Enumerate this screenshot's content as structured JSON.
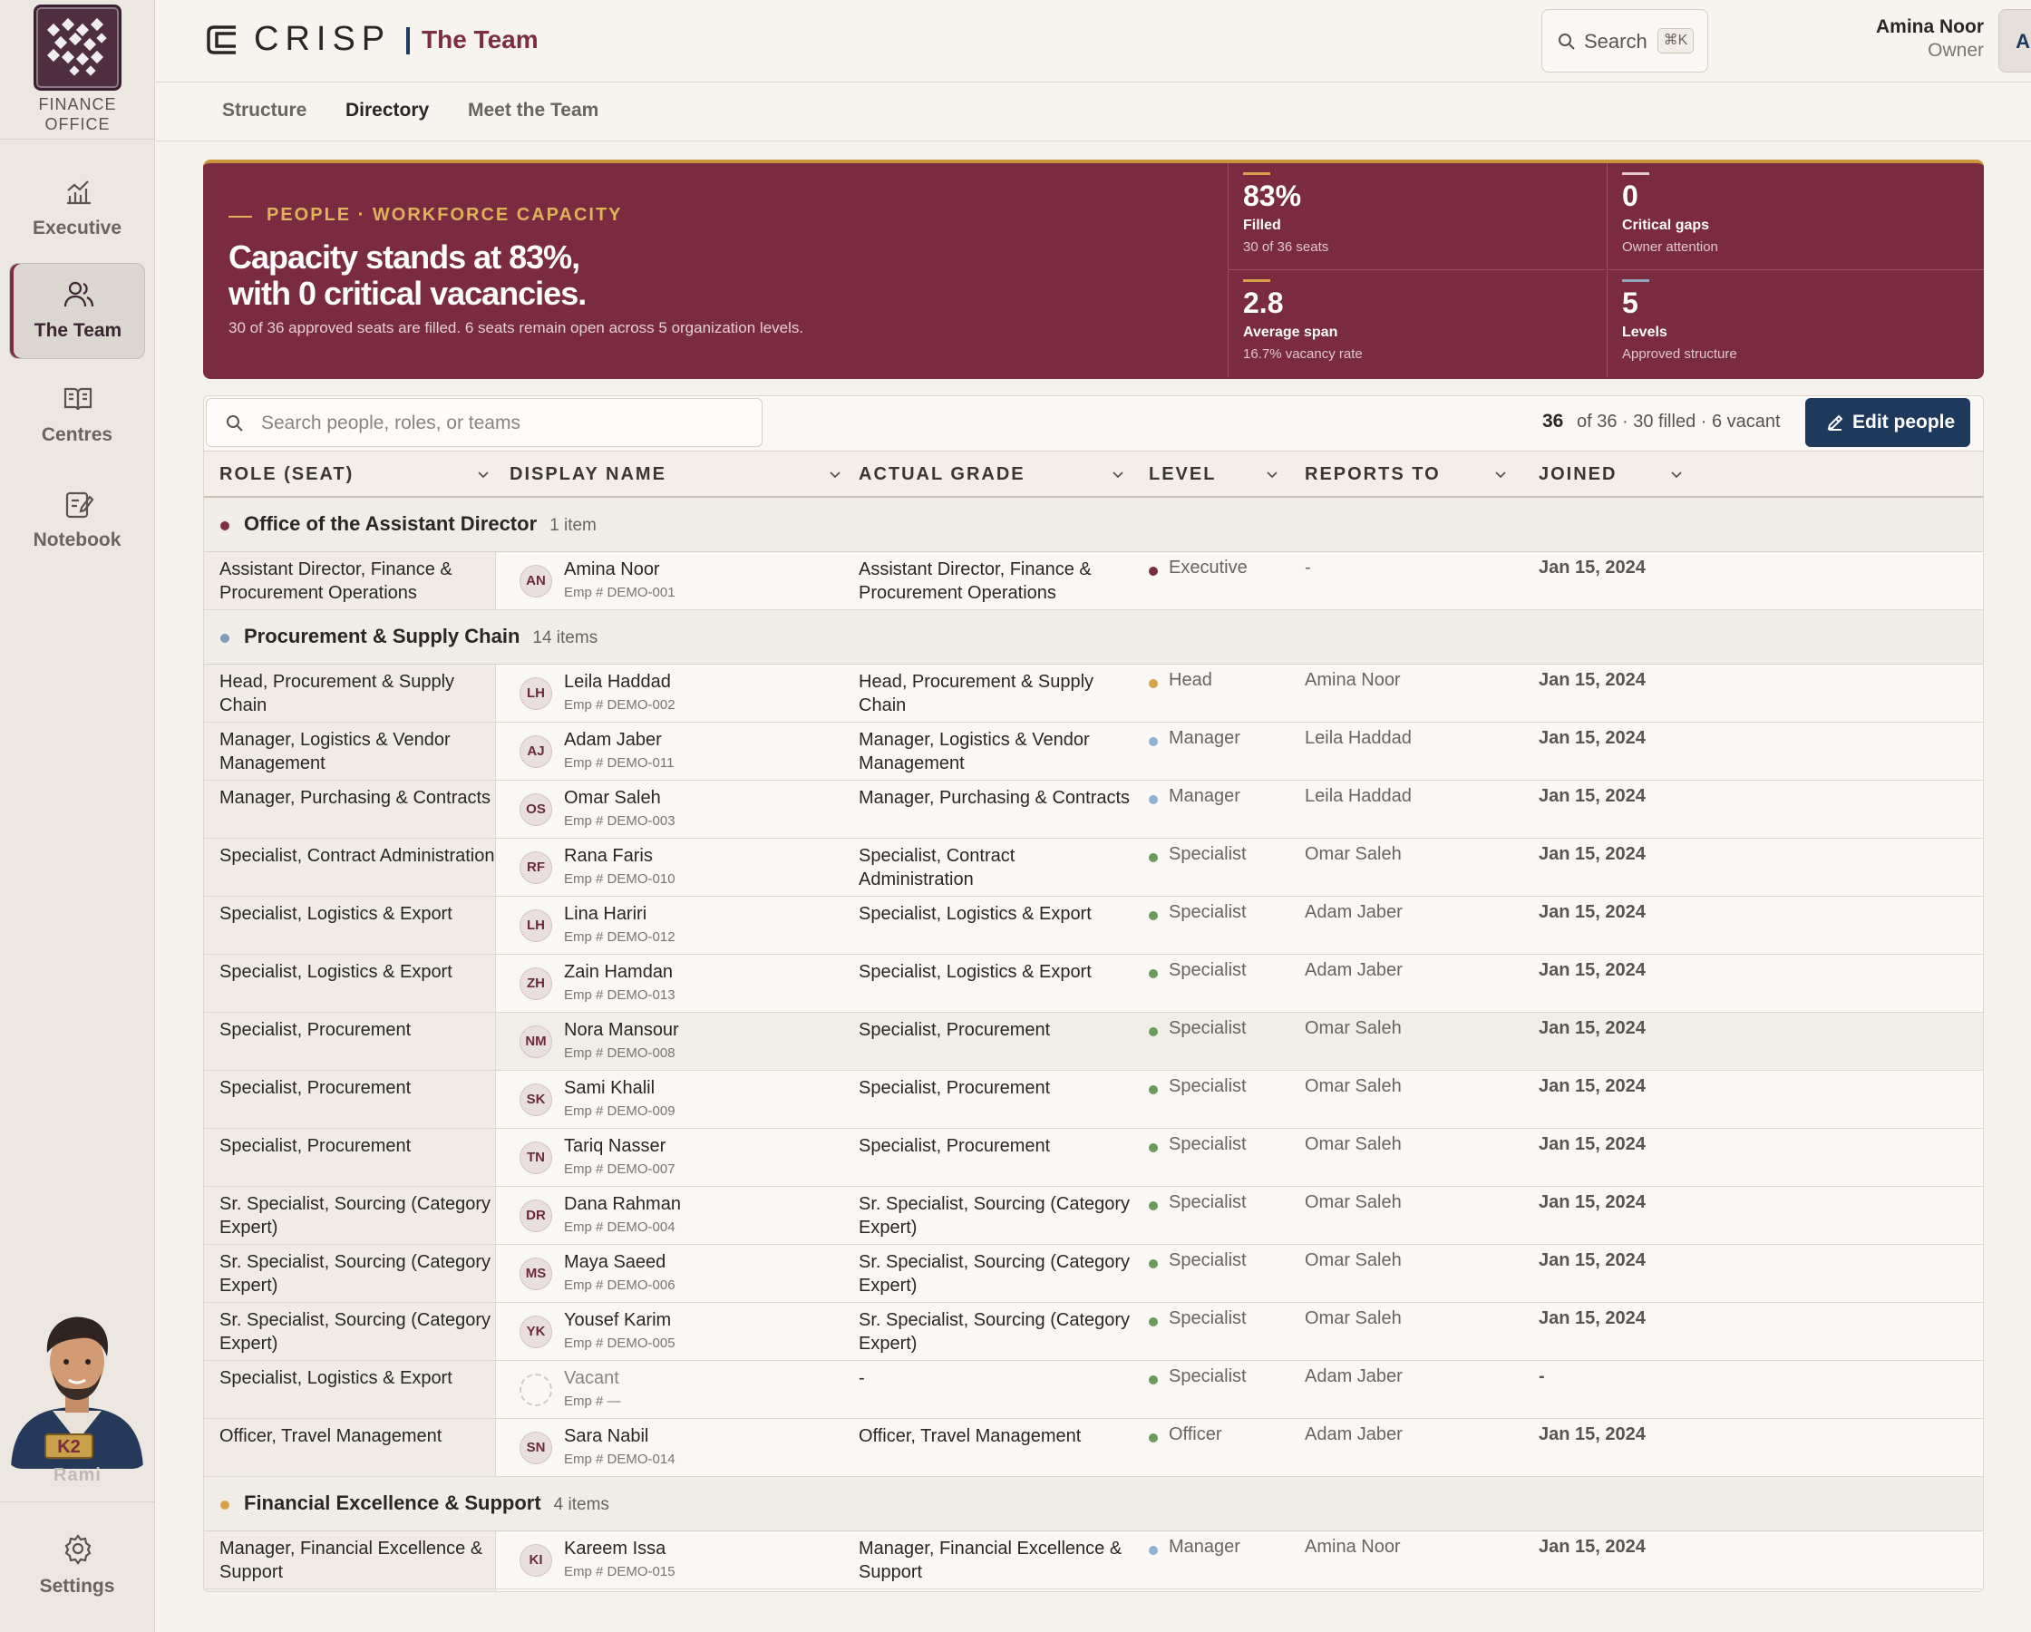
{
  "app": {
    "brand_name": "CRISP",
    "office_line1": "FINANCE",
    "office_line2": "OFFICE",
    "page_title": "The Team"
  },
  "sidebar": {
    "items": [
      {
        "label": "Executive",
        "icon": "chart-icon"
      },
      {
        "label": "The Team",
        "icon": "people-icon",
        "active": true
      },
      {
        "label": "Centres",
        "icon": "book-icon"
      },
      {
        "label": "Notebook",
        "icon": "notebook-icon"
      }
    ],
    "assistant_name": "Rami",
    "assistant_badge": "K2",
    "settings_label": "Settings"
  },
  "header": {
    "search_label": "Search",
    "search_shortcut": "⌘K",
    "user_name": "Amina Noor",
    "user_role": "Owner",
    "user_initials": "AN"
  },
  "tabs": [
    {
      "label": "Structure"
    },
    {
      "label": "Directory",
      "active": true
    },
    {
      "label": "Meet the Team"
    }
  ],
  "hero": {
    "kicker": "PEOPLE · WORKFORCE CAPACITY",
    "headline_1": "Capacity stands at 83%,",
    "headline_2": "with 0 critical vacancies.",
    "subtext": "30 of 36 approved seats are filled. 6 seats remain open across 5 organization levels.",
    "kpis": [
      {
        "value": "83%",
        "label": "Filled",
        "sub": "30 of 36 seats",
        "bar_color": "#d8a24a"
      },
      {
        "value": "0",
        "label": "Critical gaps",
        "sub": "Owner attention",
        "bar_color": "#e6c9cf"
      },
      {
        "value": "2.8",
        "label": "Average span",
        "sub": "16.7% vacancy rate",
        "bar_color": "#d8a24a"
      },
      {
        "value": "5",
        "label": "Levels",
        "sub": "Approved structure",
        "bar_color": "#8fa7bd"
      }
    ]
  },
  "table": {
    "search_placeholder": "Search people, roles, or teams",
    "count": "36",
    "count_summary": "of 36 · 30 filled · 6 vacant",
    "edit_label": "Edit people",
    "columns": [
      "ROLE (SEAT)",
      "DISPLAY NAME",
      "ACTUAL GRADE",
      "LEVEL",
      "REPORTS TO",
      "JOINED"
    ],
    "groups": [
      {
        "name": "Office of the Assistant Director",
        "count": "1 item",
        "color": "#7d2d40"
      },
      {
        "name": "Procurement & Supply Chain",
        "count": "14 items",
        "color": "#7f9cb8"
      },
      {
        "name": "Financial Excellence & Support",
        "count": "4 items",
        "color": "#d8a24a"
      }
    ],
    "level_colors": {
      "Executive": "#7d2d40",
      "Head": "#d8a24a",
      "Manager": "#8fb0d6",
      "Specialist": "#6c9a5c",
      "Officer": "#6c9a5c"
    },
    "rows": [
      {
        "role": "Assistant Director, Finance & Procurement Operations",
        "initials": "AN",
        "name": "Amina Noor",
        "emp": "Emp # DEMO-001",
        "grade": "Assistant Director, Finance & Procurement Operations",
        "level": "Executive",
        "reports": "-",
        "joined": "Jan 15, 2024"
      },
      {
        "role": "Head, Procurement & Supply Chain",
        "initials": "LH",
        "name": "Leila Haddad",
        "emp": "Emp # DEMO-002",
        "grade": "Head, Procurement & Supply Chain",
        "level": "Head",
        "reports": "Amina Noor",
        "joined": "Jan 15, 2024"
      },
      {
        "role": "Manager, Logistics & Vendor Management",
        "initials": "AJ",
        "name": "Adam Jaber",
        "emp": "Emp # DEMO-011",
        "grade": "Manager, Logistics & Vendor Management",
        "level": "Manager",
        "reports": "Leila Haddad",
        "joined": "Jan 15, 2024"
      },
      {
        "role": "Manager, Purchasing & Contracts",
        "initials": "OS",
        "name": "Omar Saleh",
        "emp": "Emp # DEMO-003",
        "grade": "Manager, Purchasing & Contracts",
        "level": "Manager",
        "reports": "Leila Haddad",
        "joined": "Jan 15, 2024"
      },
      {
        "role": "Specialist, Contract Administration",
        "initials": "RF",
        "name": "Rana Faris",
        "emp": "Emp # DEMO-010",
        "grade": "Specialist, Contract Administration",
        "level": "Specialist",
        "reports": "Omar Saleh",
        "joined": "Jan 15, 2024"
      },
      {
        "role": "Specialist, Logistics & Export",
        "initials": "LH",
        "name": "Lina Hariri",
        "emp": "Emp # DEMO-012",
        "grade": "Specialist, Logistics & Export",
        "level": "Specialist",
        "reports": "Adam Jaber",
        "joined": "Jan 15, 2024"
      },
      {
        "role": "Specialist, Logistics & Export",
        "initials": "ZH",
        "name": "Zain Hamdan",
        "emp": "Emp # DEMO-013",
        "grade": "Specialist, Logistics & Export",
        "level": "Specialist",
        "reports": "Adam Jaber",
        "joined": "Jan 15, 2024"
      },
      {
        "role": "Specialist, Procurement",
        "initials": "NM",
        "name": "Nora Mansour",
        "emp": "Emp # DEMO-008",
        "grade": "Specialist, Procurement",
        "level": "Specialist",
        "reports": "Omar Saleh",
        "joined": "Jan 15, 2024",
        "highlight": true
      },
      {
        "role": "Specialist, Procurement",
        "initials": "SK",
        "name": "Sami Khalil",
        "emp": "Emp # DEMO-009",
        "grade": "Specialist, Procurement",
        "level": "Specialist",
        "reports": "Omar Saleh",
        "joined": "Jan 15, 2024"
      },
      {
        "role": "Specialist, Procurement",
        "initials": "TN",
        "name": "Tariq Nasser",
        "emp": "Emp # DEMO-007",
        "grade": "Specialist, Procurement",
        "level": "Specialist",
        "reports": "Omar Saleh",
        "joined": "Jan 15, 2024"
      },
      {
        "role": "Sr. Specialist, Sourcing (Category Expert)",
        "initials": "DR",
        "name": "Dana Rahman",
        "emp": "Emp # DEMO-004",
        "grade": "Sr. Specialist, Sourcing (Category Expert)",
        "level": "Specialist",
        "reports": "Omar Saleh",
        "joined": "Jan 15, 2024"
      },
      {
        "role": "Sr. Specialist, Sourcing (Category Expert)",
        "initials": "MS",
        "name": "Maya Saeed",
        "emp": "Emp # DEMO-006",
        "grade": "Sr. Specialist, Sourcing (Category Expert)",
        "level": "Specialist",
        "reports": "Omar Saleh",
        "joined": "Jan 15, 2024"
      },
      {
        "role": "Sr. Specialist, Sourcing (Category Expert)",
        "initials": "YK",
        "name": "Yousef Karim",
        "emp": "Emp # DEMO-005",
        "grade": "Sr. Specialist, Sourcing (Category Expert)",
        "level": "Specialist",
        "reports": "Omar Saleh",
        "joined": "Jan 15, 2024"
      },
      {
        "role": "Specialist, Logistics & Export",
        "initials": "",
        "name": "Vacant",
        "emp": "Emp # —",
        "grade": "-",
        "level": "Specialist",
        "reports": "Adam Jaber",
        "joined": "-",
        "vacant": true
      },
      {
        "role": "Officer, Travel Management",
        "initials": "SN",
        "name": "Sara Nabil",
        "emp": "Emp # DEMO-014",
        "grade": "Officer, Travel Management",
        "level": "Officer",
        "reports": "Adam Jaber",
        "joined": "Jan 15, 2024"
      },
      {
        "role": "Manager, Financial Excellence & Support",
        "initials": "KI",
        "name": "Kareem Issa",
        "emp": "Emp # DEMO-015",
        "grade": "Manager, Financial Excellence & Support",
        "level": "Manager",
        "reports": "Amina Noor",
        "joined": "Jan 15, 2024"
      }
    ]
  }
}
